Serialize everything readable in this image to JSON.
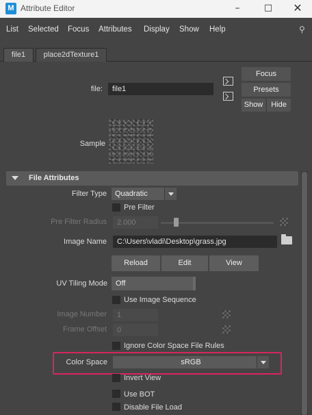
{
  "window": {
    "title": "Attribute Editor",
    "app_icon_letter": "M"
  },
  "menubar": {
    "items": [
      "List",
      "Selected",
      "Focus",
      "Attributes",
      "Display",
      "Show",
      "Help"
    ]
  },
  "tabs": [
    "file1",
    "place2dTexture1"
  ],
  "header": {
    "file_label": "file:",
    "file_value": "file1",
    "buttons": {
      "focus": "Focus",
      "presets": "Presets",
      "show": "Show",
      "hide": "Hide"
    },
    "sample_label": "Sample"
  },
  "section": {
    "title": "File Attributes",
    "filter_type": {
      "label": "Filter Type",
      "value": "Quadratic"
    },
    "pre_filter": {
      "label": "Pre Filter"
    },
    "pre_filter_radius": {
      "label": "Pre Filter Radius",
      "value": "2.000"
    },
    "image_name": {
      "label": "Image Name",
      "value": "C:\\Users\\vladi\\Desktop\\grass.jpg"
    },
    "actions": {
      "reload": "Reload",
      "edit": "Edit",
      "view": "View"
    },
    "uv_tiling": {
      "label": "UV Tiling Mode",
      "value": "Off"
    },
    "use_image_sequence": {
      "label": "Use Image Sequence"
    },
    "image_number": {
      "label": "Image Number",
      "value": "1"
    },
    "frame_offset": {
      "label": "Frame Offset",
      "value": "0"
    },
    "ignore_cs_rules": {
      "label": "Ignore Color Space File Rules"
    },
    "color_space": {
      "label": "Color Space",
      "value": "sRGB"
    },
    "invert_view": {
      "label": "Invert View"
    },
    "use_bot": {
      "label": "Use BOT"
    },
    "disable_file_load": {
      "label": "Disable File Load"
    }
  },
  "colors": {
    "highlight": "#d8255e",
    "background": "#444444",
    "field": "#2b2b2b"
  }
}
